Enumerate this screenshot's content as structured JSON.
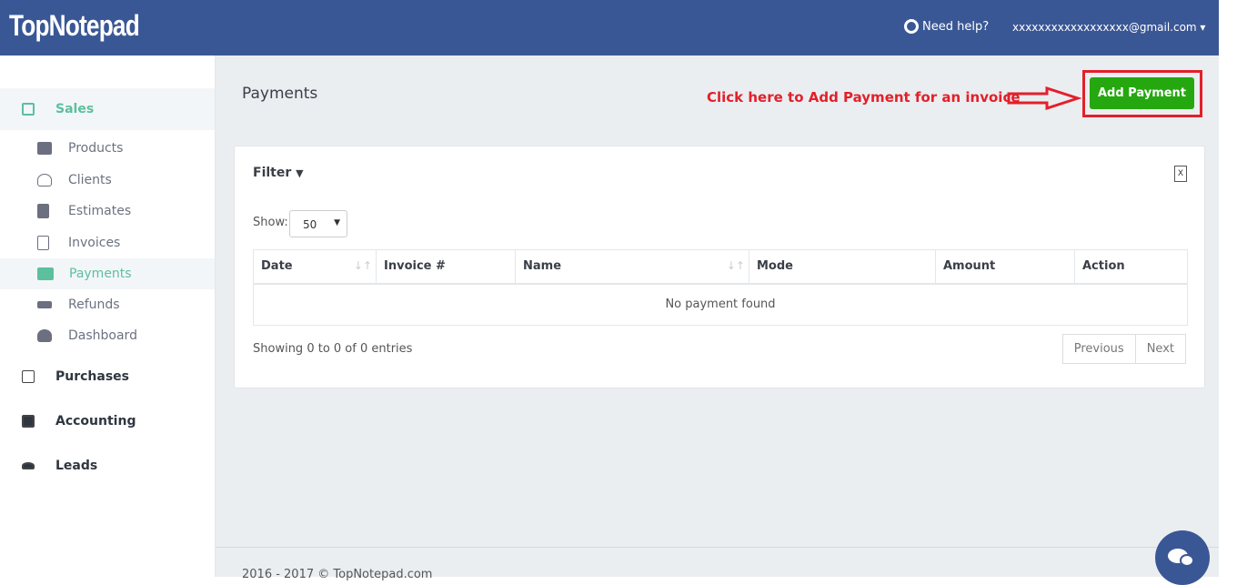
{
  "header": {
    "logo": "TopNotepad",
    "help": "Need help?",
    "user": "xxxxxxxxxxxxxxxxxx@gmail.com ▾"
  },
  "sidebar": {
    "sections": [
      {
        "label": "Sales",
        "icon": "layers-icon",
        "active": true
      },
      {
        "label": "Purchases",
        "icon": "minus-square-icon"
      },
      {
        "label": "Accounting",
        "icon": "bar-chart-icon"
      },
      {
        "label": "Leads",
        "icon": "users-icon"
      }
    ],
    "items": [
      {
        "label": "Products",
        "icon": "cubes-icon"
      },
      {
        "label": "Clients",
        "icon": "user-icon"
      },
      {
        "label": "Estimates",
        "icon": "file-icon"
      },
      {
        "label": "Invoices",
        "icon": "file-outline-icon"
      },
      {
        "label": "Payments",
        "icon": "credit-card-icon",
        "active": true
      },
      {
        "label": "Refunds",
        "icon": "exchange-icon"
      },
      {
        "label": "Dashboard",
        "icon": "dashboard-icon"
      }
    ]
  },
  "main": {
    "title": "Payments",
    "annotation": "Click here to Add Payment for an invoice",
    "add_button": "Add Payment",
    "filter": "Filter",
    "filter_icon": "▼",
    "export": "X",
    "show_label": "Show:",
    "show_value": "50",
    "columns": [
      "Date",
      "Invoice #",
      "Name",
      "Mode",
      "Amount",
      "Action"
    ],
    "empty": "No payment found",
    "info": "Showing 0 to 0 of 0 entries",
    "prev": "Previous",
    "next": "Next"
  },
  "footer": "2016 - 2017 © TopNotepad.com",
  "colors": {
    "brand": "#3a5795",
    "accent": "#5cbf9e",
    "add_button": "#25a80f",
    "annotation": "#e3202a"
  }
}
